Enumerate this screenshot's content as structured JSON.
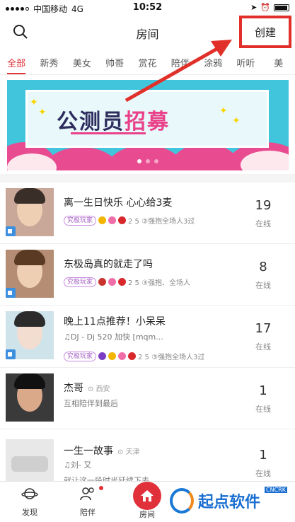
{
  "status": {
    "carrier": "中国移动",
    "network": "4G",
    "time": "10:52"
  },
  "nav": {
    "title": "房间",
    "create_label": "创建"
  },
  "tabs": [
    "全部",
    "新秀",
    "美女",
    "帅哥",
    "赏花",
    "陪伴",
    "涂鸦",
    "听听",
    "美"
  ],
  "banner": {
    "text_a": "公测员",
    "text_b": "招募",
    "pages": 3,
    "current_page": 1
  },
  "rooms": [
    {
      "name": "离一生日快乐 心心给3麦",
      "location": "",
      "subtitle": "",
      "tag": "究极玩家",
      "gifts": "2  5  ③强抱全场人3过",
      "count": "19",
      "online_label": "在线"
    },
    {
      "name": "东极岛真的就走了吗",
      "location": "",
      "subtitle": "",
      "tag": "究极玩家",
      "gifts": "2  5  ③强抱、全场人",
      "count": "8",
      "online_label": "在线"
    },
    {
      "name": "晚上11点推荐！小呆呆",
      "location": "",
      "subtitle": "♫DJ - Dj 520 加快 [mqm...",
      "tag": "究极玩家",
      "gifts": "2  5  ③强抱全场人3过",
      "count": "17",
      "online_label": "在线"
    },
    {
      "name": "杰哥",
      "location": "西安",
      "subtitle": "互相陪伴到最后",
      "tag": "",
      "gifts": "",
      "count": "1",
      "online_label": "在线"
    },
    {
      "name": "一生一故事",
      "location": "天津",
      "subtitle": "♫刘- 又",
      "subtitle2": "就让这一段时光延续下去",
      "tag": "",
      "gifts": "",
      "count": "1",
      "online_label": "在线"
    }
  ],
  "tabbar": {
    "discover": "发现",
    "company": "陪伴",
    "room": "房间"
  },
  "watermark": {
    "text": "起点软件",
    "badge": "CNCRK"
  }
}
